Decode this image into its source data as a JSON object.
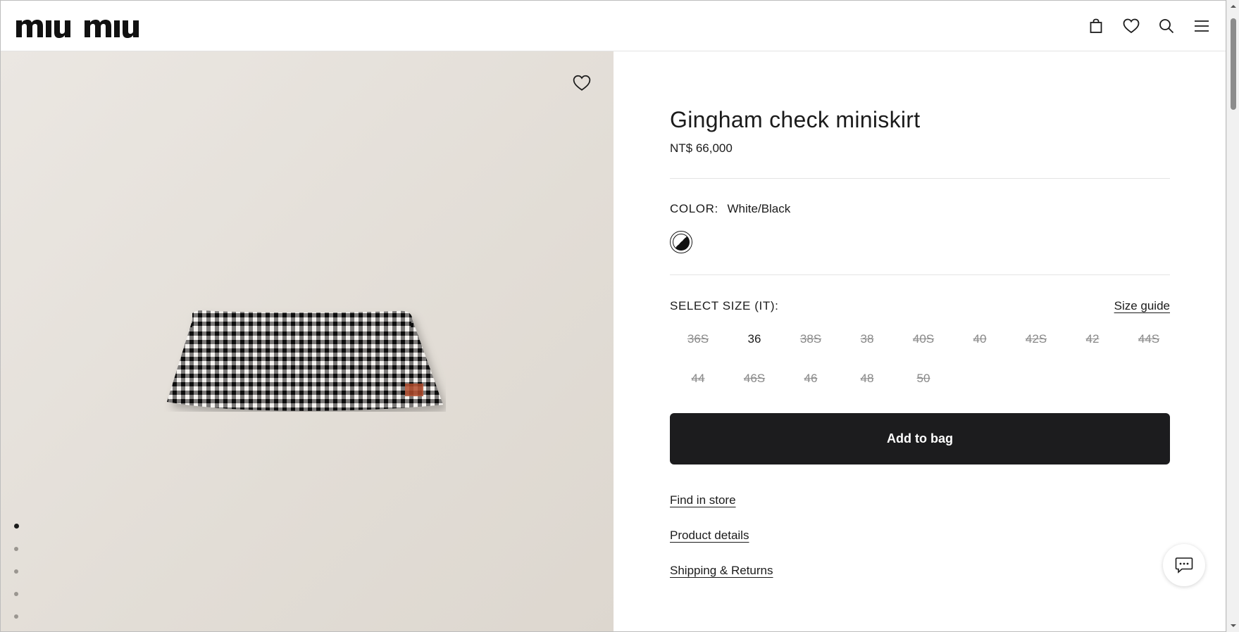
{
  "brand": {
    "logo_text": "miu miu"
  },
  "header": {
    "icons": [
      "shopping-bag-icon",
      "heart-icon",
      "search-icon",
      "menu-icon"
    ]
  },
  "gallery": {
    "image_alt": "Gingham check miniskirt",
    "image_count": 5,
    "active_index": 0
  },
  "product": {
    "title": "Gingham check miniskirt",
    "price": "NT$ 66,000",
    "color_label": "COLOR:",
    "color_value": "White/Black",
    "size_label": "SELECT SIZE (IT):",
    "size_guide": "Size guide",
    "sizes": [
      {
        "label": "36S",
        "available": false
      },
      {
        "label": "36",
        "available": true
      },
      {
        "label": "38S",
        "available": false
      },
      {
        "label": "38",
        "available": false
      },
      {
        "label": "40S",
        "available": false
      },
      {
        "label": "40",
        "available": false
      },
      {
        "label": "42S",
        "available": false
      },
      {
        "label": "42",
        "available": false
      },
      {
        "label": "44S",
        "available": false
      },
      {
        "label": "44",
        "available": false
      },
      {
        "label": "46S",
        "available": false
      },
      {
        "label": "46",
        "available": false
      },
      {
        "label": "48",
        "available": false
      },
      {
        "label": "50",
        "available": false
      }
    ],
    "add_to_bag": "Add to bag",
    "links": {
      "find_in_store": "Find in store",
      "product_details": "Product details",
      "shipping_returns": "Shipping & Returns"
    }
  },
  "colors": {
    "button": "#1c1c1e",
    "text": "#1b1b1b",
    "unavailable": "#8a8a8a",
    "image_bg": "#e4dfd8"
  }
}
